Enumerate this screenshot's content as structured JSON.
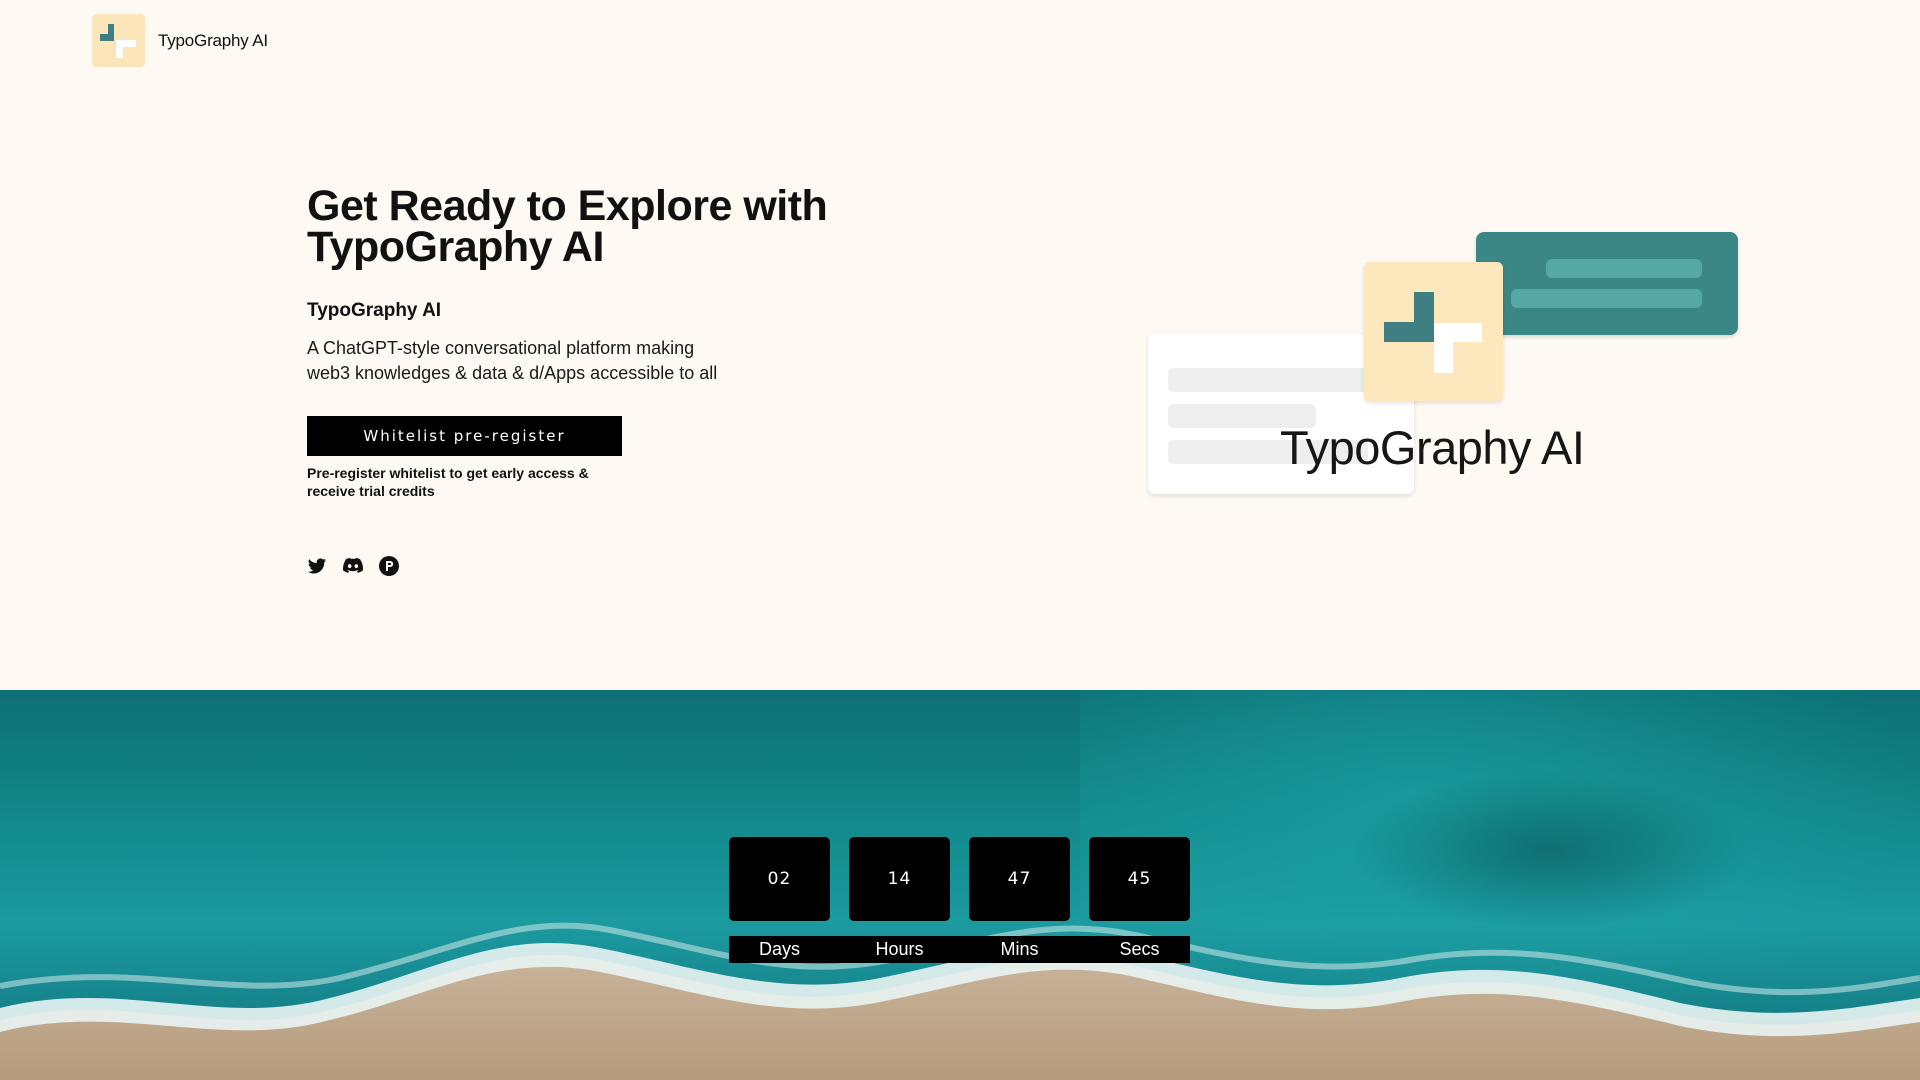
{
  "nav": {
    "brand": "TypoGraphy AI"
  },
  "hero": {
    "title_line1": "Get Ready to Explore with",
    "title_line2": "TypoGraphy AI",
    "subtitle": "TypoGraphy AI",
    "description": "A ChatGPT-style conversational platform making web3 knowledges & data & d/Apps accessible to all",
    "cta_label": "Whitelist pre-register",
    "note": "Pre-register whitelist to get early access & receive trial credits",
    "socials": [
      {
        "icon": "twitter-icon"
      },
      {
        "icon": "discord-icon"
      },
      {
        "icon": "p-circle-icon"
      }
    ]
  },
  "illustration": {
    "label": "TypoGraphy AI"
  },
  "countdown": {
    "days": "02",
    "hours": "14",
    "mins": "47",
    "secs": "45",
    "labels": {
      "days": "Days",
      "hours": "Hours",
      "mins": "Mins",
      "secs": "Secs"
    }
  },
  "colors": {
    "background": "#fefaf3",
    "tile": "#fce6b9",
    "teal": "#3b8785",
    "accent_dark": "#000000"
  }
}
